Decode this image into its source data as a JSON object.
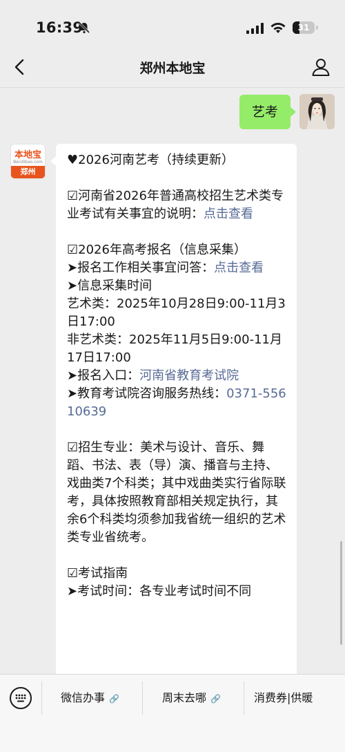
{
  "status_bar": {
    "time": "16:39",
    "battery": "31"
  },
  "nav": {
    "title": "郑州本地宝"
  },
  "user_message": {
    "text": "艺考"
  },
  "bot": {
    "avatar_logo": "本地宝",
    "avatar_sub": "Bendibao.com",
    "avatar_city": "郑州"
  },
  "message": {
    "heading": "♥2026河南艺考（持续更新）",
    "s1_text": "☑河南省2026年普通高校招生艺术类专业考试有关事宜的说明：",
    "s1_link": "点击查看",
    "s2_title": "☑2026年高考报名（信息采集）",
    "s2_q_text": "➤报名工作相关事宜问答：",
    "s2_q_link": "点击查看",
    "s2_time_title": "➤信息采集时间",
    "s2_art": "艺术类：2025年10月28日9:00-11月3日17:00",
    "s2_nonart": "非艺术类：2025年11月5日9:00-11月17日17:00",
    "s2_entry_text": "➤报名入口：",
    "s2_entry_link": "河南省教育考试院",
    "s2_hotline_text": "➤教育考试院咨询服务热线：",
    "s2_hotline_link": "0371-55610639",
    "s3_text": "☑招生专业：美术与设计、音乐、舞蹈、书法、表（导）演、播音与主持、戏曲类7个科类；其中戏曲类实行省际联考，具体按照教育部相关规定执行，其余6个科类均须参加我省统一组织的艺术类专业省统考。",
    "s4_title": "☑考试指南",
    "s4_time": "➤考试时间：各专业考试时间不同"
  },
  "menu": {
    "item1": "微信办事",
    "item2": "周末去哪",
    "item3": "消费券|供暖"
  },
  "colors": {
    "user_bubble": "#95ec69",
    "link": "#576b95",
    "brand": "#e8541e"
  }
}
